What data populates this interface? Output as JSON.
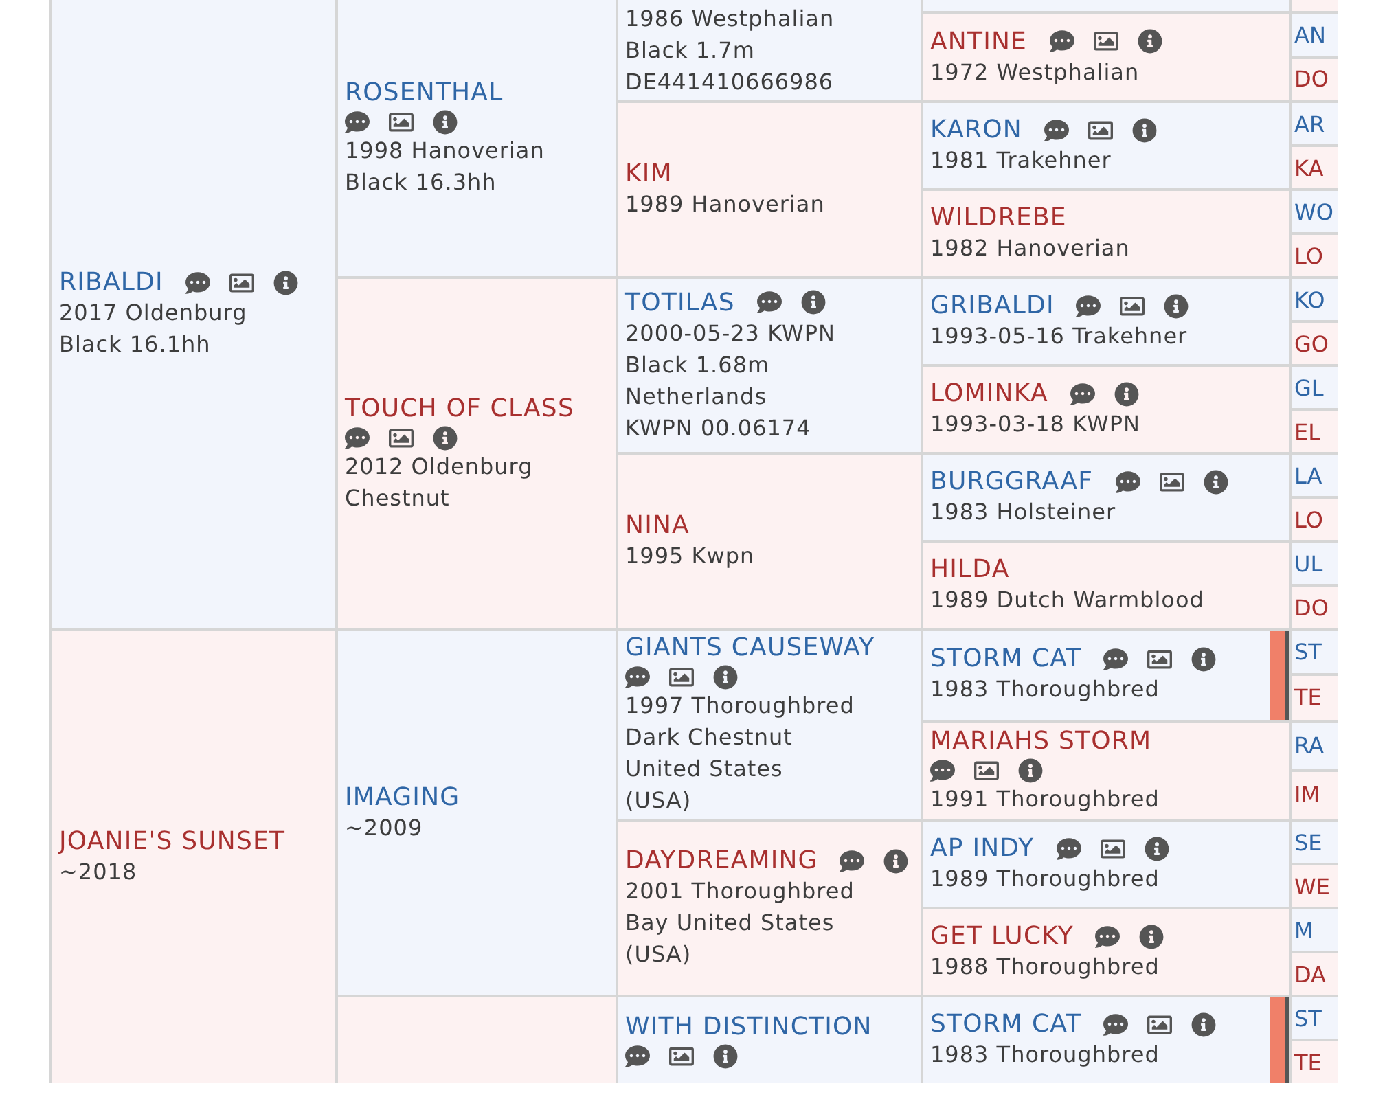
{
  "generations": [
    [
      {
        "name": "RIBALDI",
        "kind": "male",
        "lines": [
          "2017 Oldenburg",
          "Black 16.1hh"
        ],
        "comments": true,
        "photo": true,
        "info": true
      },
      {
        "name": "JOANIE'S SUNSET",
        "kind": "female",
        "lines": [
          "~2018"
        ],
        "comments": false,
        "photo": false,
        "info": false
      }
    ],
    [
      {
        "name": "ROSENTHAL",
        "kind": "male",
        "lines": [
          "1998 Hanoverian",
          "Black 16.3hh"
        ],
        "comments": true,
        "photo": true,
        "info": true
      },
      {
        "name": "TOUCH OF CLASS",
        "kind": "female",
        "lines": [
          "2012 Oldenburg",
          "Chestnut"
        ],
        "comments": true,
        "photo": true,
        "info": true
      },
      {
        "name": "IMAGING",
        "kind": "male",
        "lines": [
          "~2009"
        ],
        "comments": false,
        "photo": false,
        "info": false
      },
      {
        "kind": "female"
      }
    ],
    [
      {
        "kind": "male",
        "lines": [
          "1986 Westphalian",
          "Black 1.7m",
          "DE441410666986"
        ]
      },
      {
        "name": "KIM",
        "kind": "female",
        "lines": [
          "1989 Hanoverian"
        ],
        "comments": false,
        "photo": false,
        "info": false
      },
      {
        "name": "TOTILAS",
        "kind": "male",
        "lines": [
          "2000-05-23 KWPN",
          "Black 1.68m",
          "Netherlands",
          "KWPN 00.06174"
        ],
        "comments": true,
        "photo": false,
        "info": true
      },
      {
        "name": "NINA",
        "kind": "female",
        "lines": [
          "1995 Kwpn"
        ],
        "comments": false,
        "photo": false,
        "info": false
      },
      {
        "name": "GIANTS CAUSEWAY",
        "kind": "male",
        "lines": [
          "1997 Thoroughbred",
          "Dark Chestnut",
          "United States",
          "(USA)"
        ],
        "comments": true,
        "photo": true,
        "info": true
      },
      {
        "name": "DAYDREAMING",
        "kind": "female",
        "lines": [
          "2001 Thoroughbred",
          "Bay United States",
          "(USA)"
        ],
        "comments": true,
        "photo": false,
        "info": true
      },
      {
        "name": "WITH DISTINCTION",
        "kind": "male",
        "comments": true,
        "photo": true,
        "info": true
      }
    ],
    [
      {
        "kind": "male"
      },
      {
        "name": "ANTINE",
        "kind": "female",
        "lines": [
          "1972 Westphalian"
        ],
        "comments": true,
        "photo": true,
        "info": true,
        "highlight": false
      },
      {
        "name": "KARON",
        "kind": "male",
        "lines": [
          "1981 Trakehner"
        ],
        "comments": true,
        "photo": true,
        "info": true,
        "highlight": false
      },
      {
        "name": "WILDREBE",
        "kind": "female",
        "lines": [
          "1982 Hanoverian"
        ],
        "comments": false,
        "photo": false,
        "info": false,
        "highlight": false
      },
      {
        "name": "GRIBALDI",
        "kind": "male",
        "lines": [
          "1993-05-16 Trakehner"
        ],
        "comments": true,
        "photo": true,
        "info": true,
        "highlight": false
      },
      {
        "name": "LOMINKA",
        "kind": "female",
        "lines": [
          "1993-03-18 KWPN"
        ],
        "comments": true,
        "photo": false,
        "info": true,
        "highlight": false
      },
      {
        "name": "BURGGRAAF",
        "kind": "male",
        "lines": [
          "1983 Holsteiner"
        ],
        "comments": true,
        "photo": true,
        "info": true,
        "highlight": false
      },
      {
        "name": "HILDA",
        "kind": "female",
        "lines": [
          "1989 Dutch Warmblood"
        ],
        "comments": false,
        "photo": false,
        "info": false,
        "highlight": false
      },
      {
        "name": "STORM CAT",
        "kind": "male",
        "lines": [
          "1983 Thoroughbred"
        ],
        "comments": true,
        "photo": true,
        "info": true,
        "highlight": true
      },
      {
        "name": "MARIAHS STORM",
        "kind": "female",
        "lines": [
          "1991 Thoroughbred"
        ],
        "comments": true,
        "photo": true,
        "info": true,
        "highlight": false
      },
      {
        "name": "AP INDY",
        "kind": "male",
        "lines": [
          "1989 Thoroughbred"
        ],
        "comments": true,
        "photo": true,
        "info": true,
        "highlight": false
      },
      {
        "name": "GET LUCKY",
        "kind": "female",
        "lines": [
          "1988 Thoroughbred"
        ],
        "comments": true,
        "photo": false,
        "info": true,
        "highlight": false
      },
      {
        "name": "STORM CAT",
        "kind": "male",
        "lines": [
          "1983 Thoroughbred"
        ],
        "comments": true,
        "photo": true,
        "info": true,
        "highlight": true
      }
    ],
    [
      {
        "kind": "female"
      },
      {
        "name": "AN",
        "kind": "male"
      },
      {
        "name": "DO",
        "kind": "female"
      },
      {
        "name": "AR",
        "kind": "male"
      },
      {
        "name": "KA",
        "kind": "female"
      },
      {
        "name": "WO",
        "kind": "male"
      },
      {
        "name": "LO",
        "kind": "female"
      },
      {
        "name": "KO",
        "kind": "male"
      },
      {
        "name": "GO",
        "kind": "female"
      },
      {
        "name": "GL",
        "kind": "male"
      },
      {
        "name": "EL",
        "kind": "female"
      },
      {
        "name": "LA",
        "kind": "male"
      },
      {
        "name": "LO",
        "kind": "female"
      },
      {
        "name": "UL",
        "kind": "male"
      },
      {
        "name": "DO",
        "kind": "female"
      },
      {
        "name": "ST",
        "kind": "male"
      },
      {
        "name": "TE",
        "kind": "female"
      },
      {
        "name": "RA",
        "kind": "male"
      },
      {
        "name": "IM",
        "kind": "female"
      },
      {
        "name": "SE",
        "kind": "male"
      },
      {
        "name": "WE",
        "kind": "female"
      },
      {
        "name": "M",
        "kind": "male"
      },
      {
        "name": "DA",
        "kind": "female"
      },
      {
        "name": "ST",
        "kind": "male"
      },
      {
        "name": "TE",
        "kind": "female"
      }
    ]
  ]
}
